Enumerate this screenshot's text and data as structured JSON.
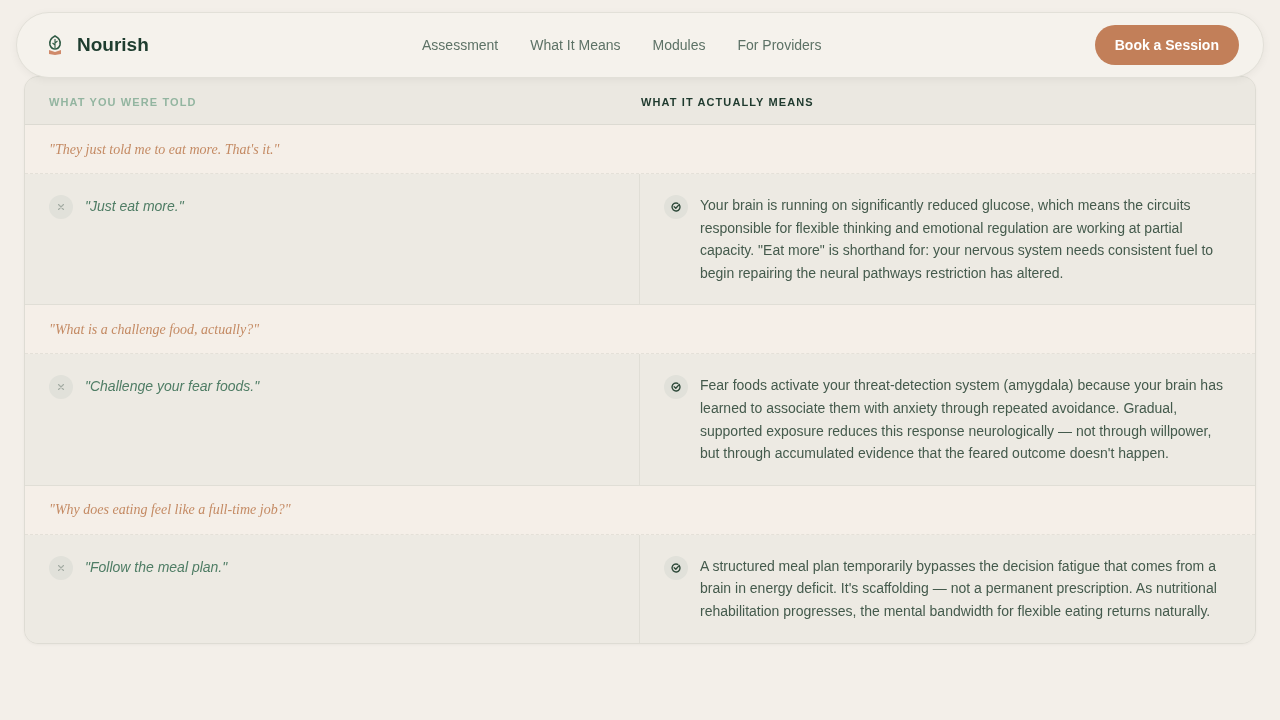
{
  "nav": {
    "brand": "Nourish",
    "links": [
      {
        "label": "Assessment"
      },
      {
        "label": "What It Means"
      },
      {
        "label": "Modules"
      },
      {
        "label": "For Providers"
      }
    ],
    "cta": "Book a Session"
  },
  "table": {
    "columns": [
      "WHAT YOU WERE TOLD",
      "WHAT IT ACTUALLY MEANS"
    ],
    "groups": [
      {
        "question": "\"They just told me to eat more. That's it.\"",
        "told": "\"Just eat more.\"",
        "means": "Your brain is running on significantly reduced glucose, which means the circuits responsible for flexible thinking and emotional regulation are working at partial capacity. \"Eat more\" is shorthand for: your nervous system needs consistent fuel to begin repairing the neural pathways restriction has altered."
      },
      {
        "question": "\"What is a challenge food, actually?\"",
        "told": "\"Challenge your fear foods.\"",
        "means": "Fear foods activate your threat-detection system (amygdala) because your brain has learned to associate them with anxiety through repeated avoidance. Gradual, supported exposure reduces this response neurologically — not through willpower, but through accumulated evidence that the feared outcome doesn't happen."
      },
      {
        "question": "\"Why does eating feel like a full-time job?\"",
        "told": "\"Follow the meal plan.\"",
        "means": "A structured meal plan temporarily bypasses the decision fatigue that comes from a brain in energy deficit. It's scaffolding — not a permanent prescription. As nutritional rehabilitation progresses, the mental bandwidth for flexible eating returns naturally."
      }
    ]
  }
}
